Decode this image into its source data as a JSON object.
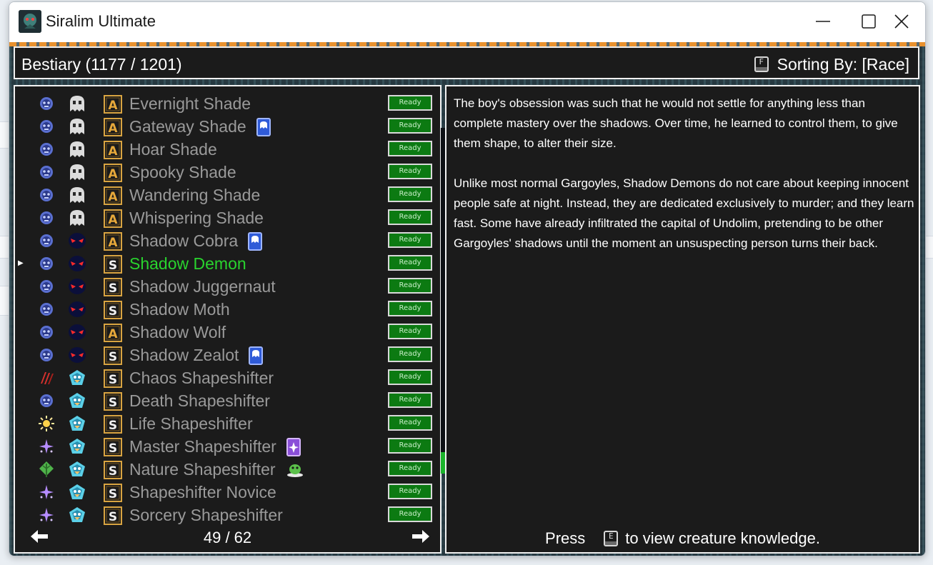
{
  "window": {
    "title": "Siralim Ultimate"
  },
  "header": {
    "title": "Bestiary (1177 / 1201)",
    "sort_key": "F",
    "sort_label": "Sorting By: [Race]"
  },
  "list": {
    "status_label": "Ready",
    "rows": [
      {
        "name": "Evernight Shade",
        "class": "death",
        "race": "ghost",
        "rank": "A",
        "extra": ""
      },
      {
        "name": "Gateway Shade",
        "class": "death",
        "race": "ghost",
        "rank": "A",
        "extra": "blue-card"
      },
      {
        "name": "Hoar Shade",
        "class": "death",
        "race": "ghost",
        "rank": "A",
        "extra": ""
      },
      {
        "name": "Spooky Shade",
        "class": "death",
        "race": "ghost",
        "rank": "A",
        "extra": ""
      },
      {
        "name": "Wandering Shade",
        "class": "death",
        "race": "ghost",
        "rank": "A",
        "extra": ""
      },
      {
        "name": "Whispering Shade",
        "class": "death",
        "race": "ghost",
        "rank": "A",
        "extra": ""
      },
      {
        "name": "Shadow Cobra",
        "class": "death",
        "race": "shadow-demon",
        "rank": "A",
        "extra": "blue-card"
      },
      {
        "name": "Shadow Demon",
        "class": "death",
        "race": "shadow-demon",
        "rank": "S",
        "extra": "",
        "selected": true
      },
      {
        "name": "Shadow Juggernaut",
        "class": "death",
        "race": "shadow-demon",
        "rank": "S",
        "extra": ""
      },
      {
        "name": "Shadow Moth",
        "class": "death",
        "race": "shadow-demon",
        "rank": "S",
        "extra": ""
      },
      {
        "name": "Shadow Wolf",
        "class": "death",
        "race": "shadow-demon",
        "rank": "A",
        "extra": ""
      },
      {
        "name": "Shadow Zealot",
        "class": "death",
        "race": "shadow-demon",
        "rank": "S",
        "extra": "blue-card"
      },
      {
        "name": "Chaos Shapeshifter",
        "class": "chaos",
        "race": "shapeshifter",
        "rank": "S",
        "extra": ""
      },
      {
        "name": "Death Shapeshifter",
        "class": "death",
        "race": "shapeshifter",
        "rank": "S",
        "extra": ""
      },
      {
        "name": "Life Shapeshifter",
        "class": "life",
        "race": "shapeshifter",
        "rank": "S",
        "extra": ""
      },
      {
        "name": "Master Shapeshifter",
        "class": "sorcery",
        "race": "shapeshifter",
        "rank": "S",
        "extra": "purple-card"
      },
      {
        "name": "Nature Shapeshifter",
        "class": "nature",
        "race": "shapeshifter",
        "rank": "S",
        "extra": "green-creature"
      },
      {
        "name": "Shapeshifter Novice",
        "class": "sorcery",
        "race": "shapeshifter",
        "rank": "S",
        "extra": ""
      },
      {
        "name": "Sorcery Shapeshifter",
        "class": "sorcery",
        "race": "shapeshifter",
        "rank": "S",
        "extra": ""
      }
    ],
    "page": "49 / 62"
  },
  "description": {
    "text": "The boy's obsession was such that he would not settle for anything less than complete mastery over the shadows. Over time, he learned to control them, to give them shape, to alter their size.\n\nUnlike most normal Gargoyles, Shadow Demons do not care about keeping innocent people safe at night. Instead, they are dedicated exclusively to murder; and they learn fast. Some have already infiltrated the capital of Undolim, pretending to be other Gargoyles' shadows until the moment an unsuspecting person turns their back.",
    "footer_press": "Press",
    "footer_key": "E",
    "footer_rest": "to view creature knowledge."
  },
  "colors": {
    "panel_bg": "#1b1b1b",
    "selected_name": "#29d42e",
    "ready_bg": "#0c7a12",
    "name_gray": "#9a9a9a"
  }
}
